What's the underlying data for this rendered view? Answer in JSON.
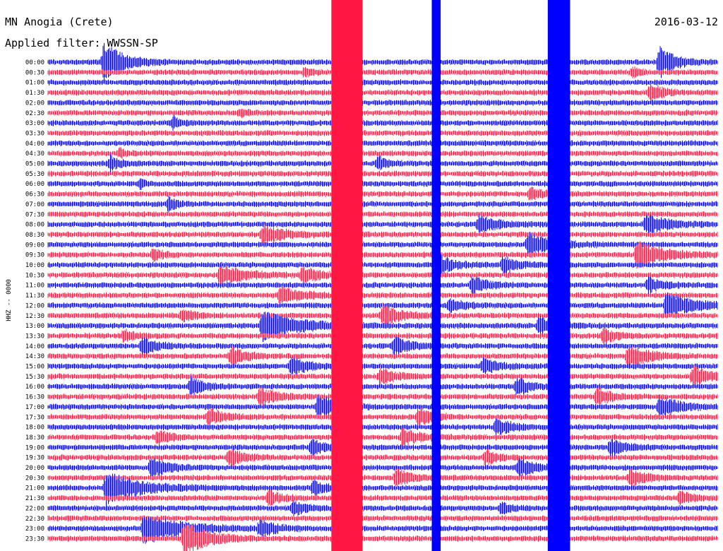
{
  "chart_data": {
    "type": "line",
    "title": "MN Anogia (Crete)",
    "subtitle": "Applied filter: WWSSN-SP",
    "date": "2016-03-12",
    "channel_label": "HHZ -- 0000",
    "row_labels": [
      "00:00",
      "00:30",
      "01:00",
      "01:30",
      "02:00",
      "02:30",
      "03:00",
      "03:30",
      "04:00",
      "04:30",
      "05:00",
      "05:30",
      "06:00",
      "06:30",
      "07:00",
      "07:30",
      "08:00",
      "08:30",
      "09:00",
      "09:30",
      "10:00",
      "10:30",
      "11:00",
      "11:30",
      "12:00",
      "12:30",
      "13:00",
      "13:30",
      "14:00",
      "14:30",
      "15:00",
      "15:30",
      "16:00",
      "16:30",
      "17:00",
      "17:30",
      "18:00",
      "18:30",
      "19:00",
      "19:30",
      "20:00",
      "20:30",
      "21:00",
      "21:30",
      "22:00",
      "22:30",
      "23:00",
      "23:30"
    ],
    "minutes_per_row": 30,
    "x_range_minutes": [
      0,
      30
    ],
    "trace_colors": [
      "#0000ff",
      "#ff1744"
    ],
    "background": "#ffffff",
    "grid": false,
    "saturated_bands": [
      {
        "start_min": 12.7,
        "end_min": 14.1,
        "color_row": "odd"
      },
      {
        "start_min": 22.4,
        "end_min": 23.4,
        "color_row": "even"
      },
      {
        "start_min": 17.2,
        "end_min": 17.6,
        "color_row": "even"
      }
    ],
    "events": [
      {
        "row": 0,
        "minute": 2.5,
        "amp": 28,
        "decay": 0.8
      },
      {
        "row": 0,
        "minute": 27.4,
        "amp": 22,
        "decay": 0.6
      },
      {
        "row": 1,
        "minute": 11.5,
        "amp": 6,
        "decay": 0.3
      },
      {
        "row": 1,
        "minute": 26.2,
        "amp": 6,
        "decay": 0.3
      },
      {
        "row": 3,
        "minute": 27.0,
        "amp": 14,
        "decay": 0.5
      },
      {
        "row": 5,
        "minute": 8.6,
        "amp": 5,
        "decay": 0.3
      },
      {
        "row": 6,
        "minute": 5.6,
        "amp": 9,
        "decay": 0.3
      },
      {
        "row": 9,
        "minute": 3.2,
        "amp": 6,
        "decay": 0.3
      },
      {
        "row": 10,
        "minute": 2.8,
        "amp": 10,
        "decay": 0.4
      },
      {
        "row": 10,
        "minute": 14.8,
        "amp": 10,
        "decay": 0.4
      },
      {
        "row": 12,
        "minute": 4.1,
        "amp": 6,
        "decay": 0.3
      },
      {
        "row": 13,
        "minute": 21.6,
        "amp": 9,
        "decay": 0.5
      },
      {
        "row": 14,
        "minute": 5.4,
        "amp": 10,
        "decay": 0.3
      },
      {
        "row": 16,
        "minute": 19.3,
        "amp": 12,
        "decay": 0.8
      },
      {
        "row": 16,
        "minute": 26.8,
        "amp": 14,
        "decay": 0.9
      },
      {
        "row": 17,
        "minute": 9.6,
        "amp": 12,
        "decay": 1.0
      },
      {
        "row": 18,
        "minute": 21.5,
        "amp": 16,
        "decay": 1.0
      },
      {
        "row": 19,
        "minute": 4.7,
        "amp": 8,
        "decay": 0.4
      },
      {
        "row": 19,
        "minute": 26.4,
        "amp": 18,
        "decay": 1.1
      },
      {
        "row": 20,
        "minute": 17.6,
        "amp": 12,
        "decay": 0.6
      },
      {
        "row": 20,
        "minute": 20.4,
        "amp": 12,
        "decay": 0.6
      },
      {
        "row": 21,
        "minute": 7.7,
        "amp": 14,
        "decay": 1.0
      },
      {
        "row": 21,
        "minute": 11.4,
        "amp": 10,
        "decay": 0.8
      },
      {
        "row": 22,
        "minute": 19.0,
        "amp": 12,
        "decay": 0.6
      },
      {
        "row": 22,
        "minute": 26.9,
        "amp": 10,
        "decay": 0.6
      },
      {
        "row": 23,
        "minute": 10.4,
        "amp": 12,
        "decay": 0.9
      },
      {
        "row": 24,
        "minute": 18.0,
        "amp": 10,
        "decay": 0.6
      },
      {
        "row": 24,
        "minute": 27.7,
        "amp": 18,
        "decay": 1.1
      },
      {
        "row": 25,
        "minute": 6.0,
        "amp": 8,
        "decay": 0.5
      },
      {
        "row": 25,
        "minute": 15.0,
        "amp": 14,
        "decay": 0.8
      },
      {
        "row": 26,
        "minute": 9.6,
        "amp": 20,
        "decay": 1.6
      },
      {
        "row": 26,
        "minute": 22.0,
        "amp": 12,
        "decay": 0.7
      },
      {
        "row": 27,
        "minute": 3.4,
        "amp": 8,
        "decay": 0.5
      },
      {
        "row": 27,
        "minute": 24.9,
        "amp": 10,
        "decay": 0.5
      },
      {
        "row": 28,
        "minute": 4.2,
        "amp": 12,
        "decay": 0.6
      },
      {
        "row": 28,
        "minute": 15.5,
        "amp": 12,
        "decay": 0.7
      },
      {
        "row": 29,
        "minute": 8.2,
        "amp": 12,
        "decay": 0.6
      },
      {
        "row": 29,
        "minute": 26.0,
        "amp": 16,
        "decay": 0.8
      },
      {
        "row": 30,
        "minute": 10.9,
        "amp": 12,
        "decay": 0.7
      },
      {
        "row": 30,
        "minute": 19.5,
        "amp": 10,
        "decay": 0.6
      },
      {
        "row": 31,
        "minute": 14.9,
        "amp": 12,
        "decay": 0.6
      },
      {
        "row": 31,
        "minute": 28.9,
        "amp": 14,
        "decay": 0.7
      },
      {
        "row": 32,
        "minute": 6.4,
        "amp": 12,
        "decay": 0.6
      },
      {
        "row": 32,
        "minute": 21.0,
        "amp": 12,
        "decay": 0.6
      },
      {
        "row": 33,
        "minute": 9.5,
        "amp": 12,
        "decay": 0.7
      },
      {
        "row": 33,
        "minute": 24.6,
        "amp": 12,
        "decay": 0.6
      },
      {
        "row": 34,
        "minute": 12.1,
        "amp": 16,
        "decay": 0.8
      },
      {
        "row": 34,
        "minute": 27.4,
        "amp": 16,
        "decay": 0.8
      },
      {
        "row": 35,
        "minute": 7.2,
        "amp": 12,
        "decay": 0.6
      },
      {
        "row": 35,
        "minute": 16.6,
        "amp": 12,
        "decay": 0.6
      },
      {
        "row": 36,
        "minute": 20.1,
        "amp": 12,
        "decay": 0.6
      },
      {
        "row": 37,
        "minute": 4.9,
        "amp": 10,
        "decay": 0.5
      },
      {
        "row": 37,
        "minute": 15.9,
        "amp": 12,
        "decay": 0.7
      },
      {
        "row": 38,
        "minute": 11.8,
        "amp": 10,
        "decay": 0.6
      },
      {
        "row": 38,
        "minute": 25.2,
        "amp": 12,
        "decay": 0.6
      },
      {
        "row": 39,
        "minute": 8.1,
        "amp": 12,
        "decay": 0.6
      },
      {
        "row": 39,
        "minute": 19.6,
        "amp": 10,
        "decay": 0.5
      },
      {
        "row": 40,
        "minute": 4.6,
        "amp": 14,
        "decay": 0.7
      },
      {
        "row": 40,
        "minute": 21.1,
        "amp": 14,
        "decay": 0.6
      },
      {
        "row": 41,
        "minute": 15.6,
        "amp": 12,
        "decay": 0.6
      },
      {
        "row": 41,
        "minute": 26.1,
        "amp": 12,
        "decay": 0.6
      },
      {
        "row": 42,
        "minute": 2.6,
        "amp": 22,
        "decay": 1.4
      },
      {
        "row": 42,
        "minute": 11.9,
        "amp": 10,
        "decay": 0.5
      },
      {
        "row": 43,
        "minute": 9.9,
        "amp": 10,
        "decay": 0.5
      },
      {
        "row": 43,
        "minute": 28.3,
        "amp": 10,
        "decay": 0.5
      },
      {
        "row": 44,
        "minute": 11.0,
        "amp": 10,
        "decay": 0.5
      },
      {
        "row": 44,
        "minute": 20.3,
        "amp": 8,
        "decay": 0.4
      },
      {
        "row": 46,
        "minute": 4.3,
        "amp": 22,
        "decay": 1.5
      },
      {
        "row": 46,
        "minute": 9.5,
        "amp": 12,
        "decay": 0.6
      },
      {
        "row": 47,
        "minute": 6.1,
        "amp": 22,
        "decay": 1.0
      }
    ]
  }
}
